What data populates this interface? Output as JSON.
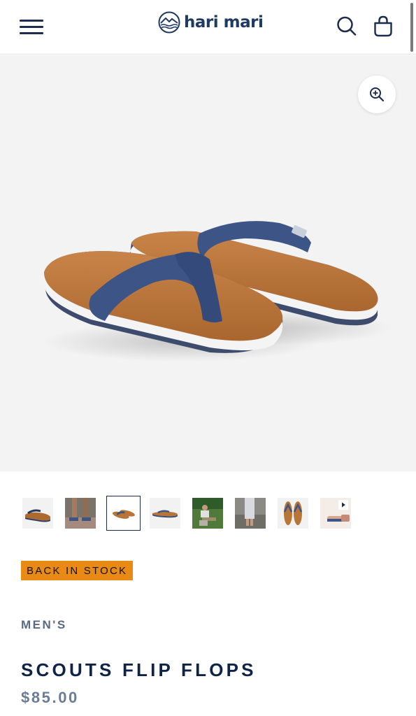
{
  "header": {
    "brand": "hari mari",
    "menu_icon": "hamburger-menu-icon",
    "search_icon": "search-icon",
    "cart_icon": "shopping-bag-icon"
  },
  "gallery": {
    "zoom_icon": "zoom-in-icon",
    "main_image": "navy-and-tan-flip-flops",
    "thumbnails": [
      {
        "name": "side-view-flip-flop"
      },
      {
        "name": "feet-on-rocks"
      },
      {
        "name": "pair-front-view",
        "active": true
      },
      {
        "name": "side-profile"
      },
      {
        "name": "man-on-grass"
      },
      {
        "name": "woman-outdoors"
      },
      {
        "name": "top-down-pair"
      },
      {
        "name": "video",
        "play_icon": "play-icon"
      }
    ]
  },
  "product": {
    "badge": "BACK IN STOCK",
    "category": "MEN'S",
    "title": "SCOUTS FLIP FLOPS",
    "price": "$85.00"
  },
  "colors": {
    "navy": "#1c2d4f",
    "badge": "#e98a14",
    "tan": "#b87538",
    "strap": "#3d5486"
  }
}
